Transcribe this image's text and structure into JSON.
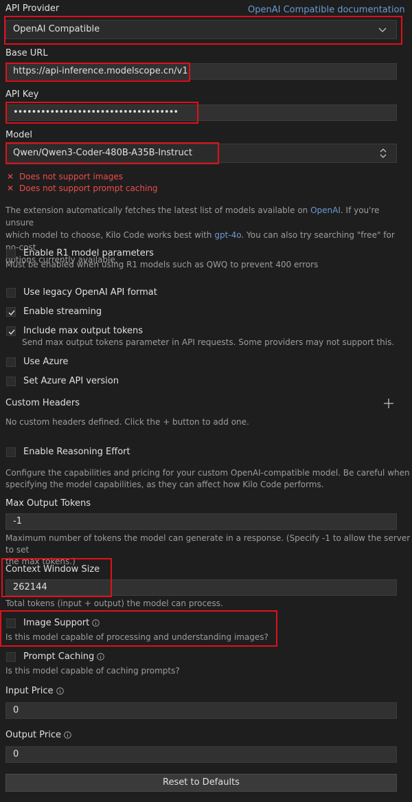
{
  "provider": {
    "label": "API Provider",
    "doc_link": "OpenAI Compatible documentation",
    "value": "OpenAI Compatible"
  },
  "base_url": {
    "label": "Base URL",
    "value": "https://api-inference.modelscope.cn/v1"
  },
  "api_key": {
    "label": "API Key",
    "value": "••••••••••••••••••••••••••••••••••••"
  },
  "model": {
    "label": "Model",
    "value": "Qwen/Qwen3-Coder-480B-A35B-Instruct",
    "errors": [
      "Does not support images",
      "Does not support prompt caching"
    ]
  },
  "info": {
    "part1": "The extension automatically fetches the latest list of models available on ",
    "link1": "OpenAI",
    "part2": ". If you're unsure",
    "line2a": "which model to choose, Kilo Code works best with ",
    "link2": "gpt-4o",
    "line2b": ". You can also try searching \"free\" for no-cost",
    "line3": "options currently available."
  },
  "options": {
    "r1": {
      "label": "Enable R1 model parameters",
      "desc": "Must be enabled when using R1 models such as QWQ to prevent 400 errors",
      "checked": false
    },
    "legacy": {
      "label": "Use legacy OpenAI API format",
      "checked": false
    },
    "streaming": {
      "label": "Enable streaming",
      "checked": true
    },
    "max_tokens": {
      "label": "Include max output tokens",
      "desc": "Send max output tokens parameter in API requests. Some providers may not support this.",
      "checked": true
    },
    "azure": {
      "label": "Use Azure",
      "checked": false
    },
    "azure_version": {
      "label": "Set Azure API version",
      "checked": false
    }
  },
  "custom_headers": {
    "title": "Custom Headers",
    "empty": "No custom headers defined. Click the + button to add one."
  },
  "reasoning": {
    "label": "Enable Reasoning Effort",
    "checked": false
  },
  "capabilities": {
    "line1": "Configure the capabilities and pricing for your custom OpenAI-compatible model. Be careful when",
    "line2": "specifying the model capabilities, as they can affect how Kilo Code performs."
  },
  "max_output": {
    "label": "Max Output Tokens",
    "value": "-1",
    "desc1": "Maximum number of tokens the model can generate in a response. (Specify -1 to allow the server to set",
    "desc2": "the max tokens.)"
  },
  "context_window": {
    "label": "Context Window Size",
    "value": "262144",
    "desc": "Total tokens (input + output) the model can process."
  },
  "image_support": {
    "label": "Image Support",
    "desc": "Is this model capable of processing and understanding images?",
    "checked": false
  },
  "prompt_caching": {
    "label": "Prompt Caching",
    "desc": "Is this model capable of caching prompts?",
    "checked": false
  },
  "input_price": {
    "label": "Input Price",
    "value": "0"
  },
  "output_price": {
    "label": "Output Price",
    "value": "0"
  },
  "reset_label": "Reset to Defaults",
  "colors": {
    "background": "#1e1e1e",
    "highlight": "#e0101b",
    "error": "#f14c4c",
    "link": "#6a9bd1"
  }
}
